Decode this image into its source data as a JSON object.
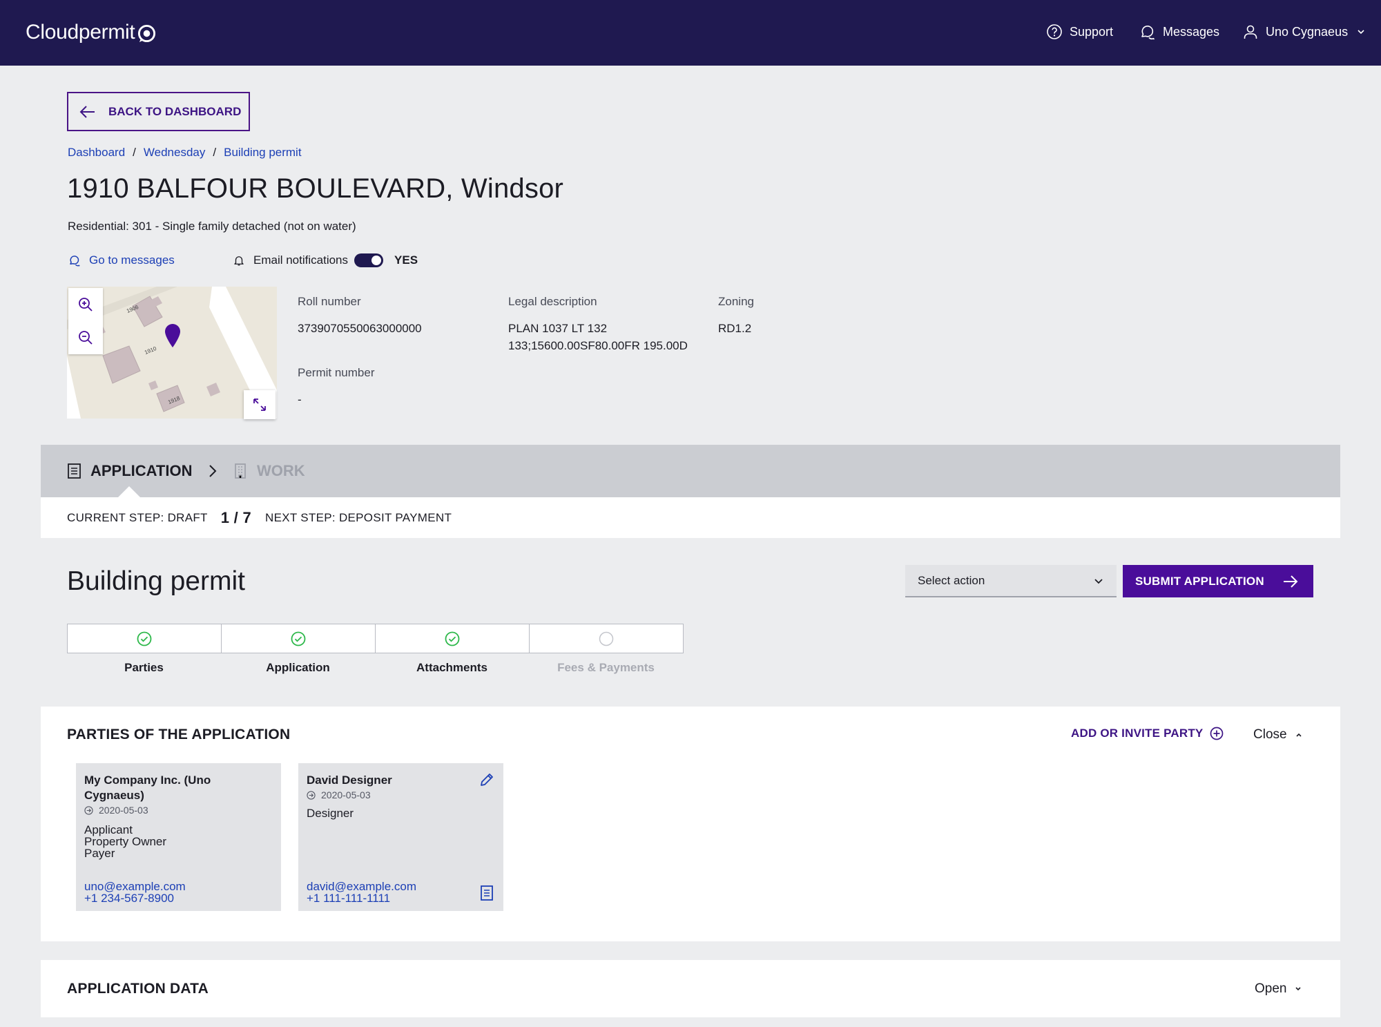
{
  "app": {
    "logo": "Cloudpermit",
    "nav": {
      "support": "Support",
      "messages": "Messages",
      "user": "Uno Cygnaeus"
    }
  },
  "back_button": "BACK TO DASHBOARD",
  "breadcrumb": [
    "Dashboard",
    "Wednesday",
    "Building permit"
  ],
  "title": "1910 BALFOUR BOULEVARD, Windsor",
  "subtitle": "Residential: 301 - Single family detached (not on water)",
  "links": {
    "go_to_messages": "Go to messages",
    "email_notifications": "Email notifications",
    "email_toggle_value": "YES"
  },
  "map": {
    "lot_labels": [
      "1906",
      "1910",
      "1918"
    ]
  },
  "property": {
    "roll_number": {
      "label": "Roll number",
      "value": "3739070550063000000"
    },
    "legal_description": {
      "label": "Legal description",
      "value_line1": "PLAN 1037 LT 132",
      "value_line2": "133;15600.00SF80.00FR 195.00D"
    },
    "zoning": {
      "label": "Zoning",
      "value": "RD1.2"
    },
    "permit_number": {
      "label": "Permit number",
      "value": "-"
    }
  },
  "phases": {
    "application": "APPLICATION",
    "work": "WORK"
  },
  "current_step": {
    "current": "CURRENT STEP: DRAFT",
    "progress": "1 / 7",
    "next": "NEXT STEP: DEPOSIT PAYMENT"
  },
  "permit": {
    "title": "Building permit",
    "select_action": "Select action",
    "submit": "SUBMIT APPLICATION"
  },
  "wizard_steps": [
    {
      "label": "Parties",
      "status": "complete"
    },
    {
      "label": "Application",
      "status": "complete"
    },
    {
      "label": "Attachments",
      "status": "complete"
    },
    {
      "label": "Fees & Payments",
      "status": "pending"
    }
  ],
  "parties_section": {
    "title": "PARTIES OF THE APPLICATION",
    "add_party": "ADD OR INVITE PARTY",
    "toggle": "Close",
    "cards": [
      {
        "name": "My Company Inc. (Uno Cygnaeus)",
        "date": "2020-05-03",
        "roles": [
          "Applicant",
          "Property Owner",
          "Payer"
        ],
        "email": "uno@example.com",
        "phone": "+1 234-567-8900"
      },
      {
        "name": "David Designer",
        "date": "2020-05-03",
        "roles": [
          "Designer"
        ],
        "email": "david@example.com",
        "phone": "+1 111-111-1111"
      }
    ]
  },
  "application_data_section": {
    "title": "APPLICATION DATA",
    "toggle": "Open"
  },
  "colors": {
    "header": "#1f1950",
    "accent": "#4a0d9a",
    "link": "#1c3fb5",
    "success": "#2db84a"
  }
}
